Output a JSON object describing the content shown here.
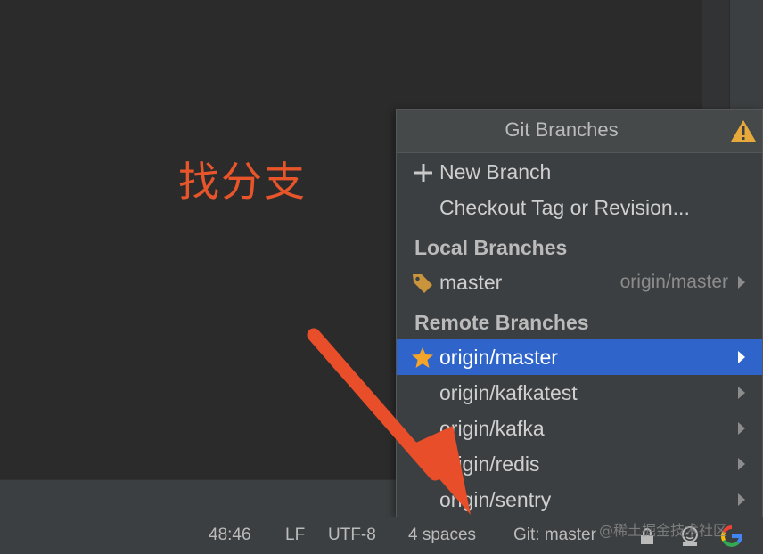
{
  "annotation": "找分支",
  "popup": {
    "title": "Git Branches",
    "actions": {
      "new_branch": "New Branch",
      "checkout": "Checkout Tag or Revision..."
    },
    "local_heading": "Local Branches",
    "local_branches": [
      {
        "name": "master",
        "tracking": "origin/master"
      }
    ],
    "remote_heading": "Remote Branches",
    "remote_branches": [
      {
        "name": "origin/master",
        "selected": true,
        "favorite": true
      },
      {
        "name": "origin/kafkatest"
      },
      {
        "name": "origin/kafka"
      },
      {
        "name": "origin/redis"
      },
      {
        "name": "origin/sentry"
      }
    ]
  },
  "statusbar": {
    "position": "48:46",
    "line_separator": "LF",
    "encoding": "UTF-8",
    "indent": "4 spaces",
    "git_branch": "Git: master"
  },
  "watermark": "@稀土掘金技术社区",
  "icons": {
    "add": "plus-icon",
    "tag": "tag-icon",
    "favorite": "star-icon",
    "warning": "warning-icon",
    "lock": "lock-icon",
    "inspector": "inspector-face-icon",
    "google": "google-icon"
  },
  "colors": {
    "selection": "#2f65ca",
    "annotation": "#e8552a",
    "star": "#f4a428",
    "warning": "#e8a93b"
  }
}
